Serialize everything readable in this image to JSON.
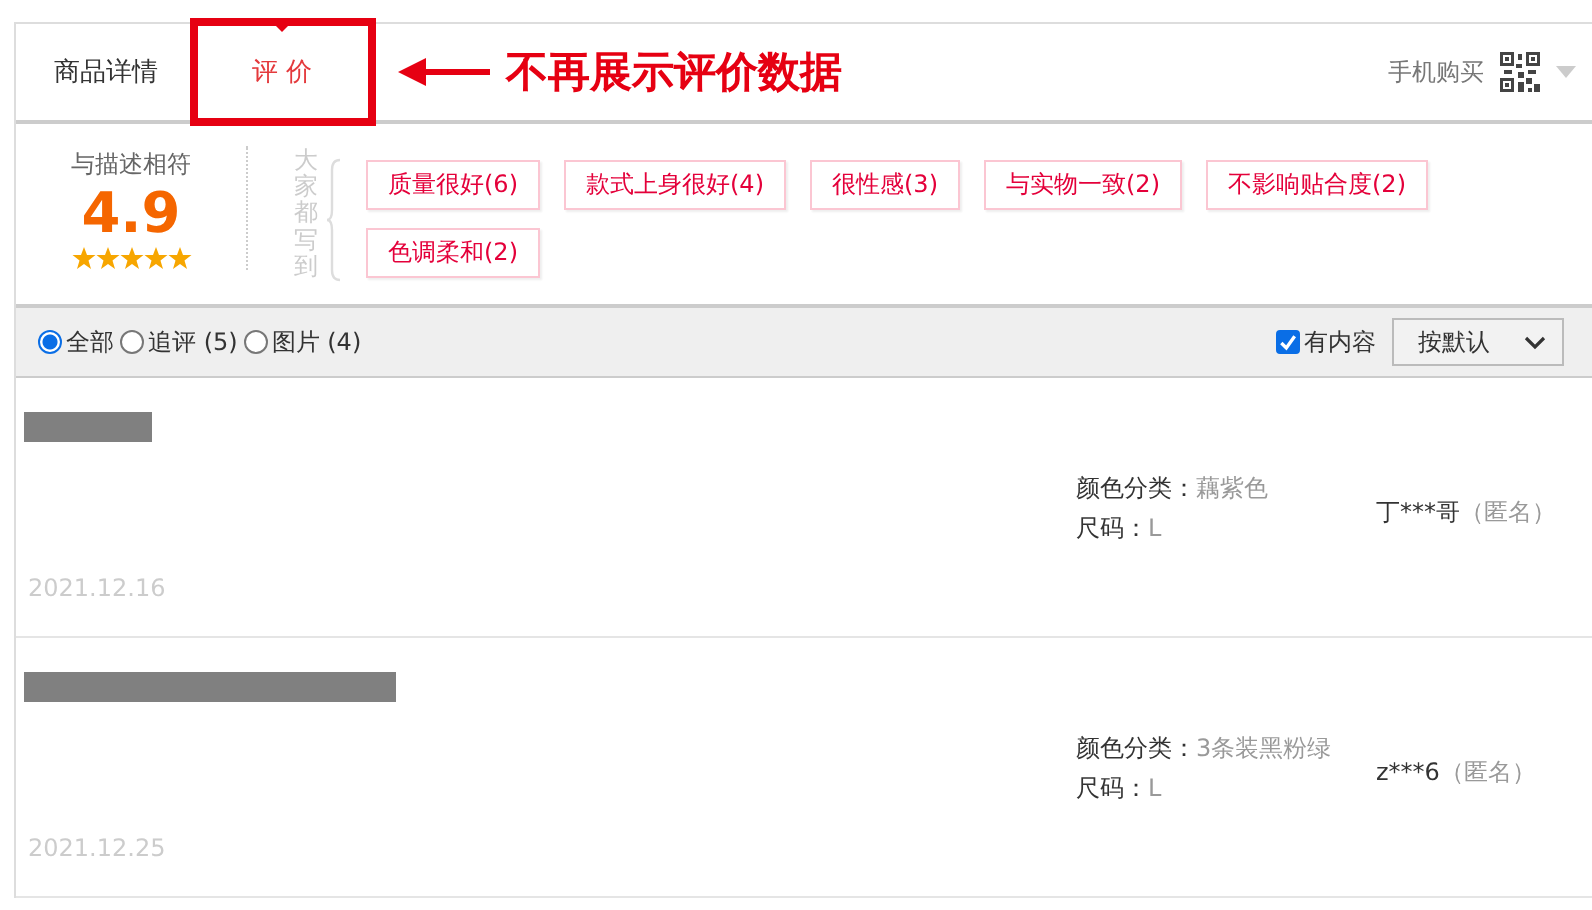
{
  "tabs": [
    {
      "label": "商品详情",
      "selected": false
    },
    {
      "label": "评 价",
      "selected": true
    }
  ],
  "annotation": {
    "text": "不再展示评价数据"
  },
  "mobile_buy": {
    "label": "手机购买"
  },
  "rating": {
    "label": "与描述相符",
    "score": "4.9",
    "stars": 5
  },
  "tags_heading": "大家都写到",
  "tags": [
    "质量很好(6)",
    "款式上身很好(4)",
    "很性感(3)",
    "与实物一致(2)",
    "不影响贴合度(2)",
    "色调柔和(2)"
  ],
  "filters": [
    {
      "label": "全部",
      "selected": true
    },
    {
      "label": "追评 (5)",
      "selected": false
    },
    {
      "label": "图片 (4)",
      "selected": false
    }
  ],
  "has_content": {
    "label": "有内容",
    "checked": true
  },
  "sort": {
    "value": "按默认"
  },
  "reviews": [
    {
      "kind": "short",
      "sku": [
        {
          "label": "颜色分类：",
          "value": "藕紫色"
        },
        {
          "label": "尺码：",
          "value": "L"
        }
      ],
      "user": "丁***哥",
      "anonymous": "（匿名）",
      "date": "2021.12.16"
    },
    {
      "kind": "long",
      "sku": [
        {
          "label": "颜色分类：",
          "value": "3条装黑粉绿"
        },
        {
          "label": "尺码：",
          "value": "L"
        }
      ],
      "user": "z***6",
      "anonymous": "（匿名）",
      "date": "2021.12.25"
    }
  ]
}
